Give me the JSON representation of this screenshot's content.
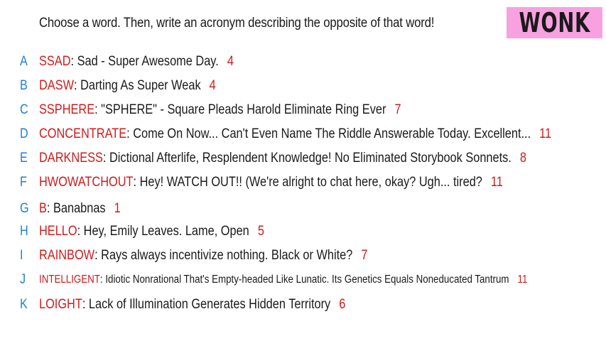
{
  "prompt": "Choose a word. Then, write an acronym describing the opposite of that word!",
  "logo": "WONK",
  "colors": {
    "letter": "#1e7fd6",
    "word": "#d21a1a",
    "score": "#d21a1a",
    "logo_bg": "#f7a1e0"
  },
  "entries": [
    {
      "letter": "A",
      "word": "SSAD",
      "expansion": "Sad - Super Awesome Day.",
      "score": "4"
    },
    {
      "letter": "B",
      "word": "DASW",
      "expansion": "Darting As Super Weak",
      "score": "4"
    },
    {
      "letter": "C",
      "word": "SSPHERE",
      "expansion": "\"SPHERE\" - Square Pleads Harold Eliminate Ring Ever",
      "score": "7"
    },
    {
      "letter": "D",
      "word": "CONCENTRATE",
      "expansion": "Come On Now... Can't Even Name The Riddle Answerable Today. Excellent...",
      "score": "11"
    },
    {
      "letter": "E",
      "word": "DARKNESS",
      "expansion": "Dictional Afterlife, Resplendent Knowledge! No Eliminated Storybook Sonnets.",
      "score": "8"
    },
    {
      "letter": "F",
      "word": "HWOWATCHOUT",
      "expansion": "Hey! WATCH OUT!! (We're alright to chat here, okay? Ugh... tired?",
      "score": "11"
    },
    {
      "letter": "G",
      "word": "B",
      "expansion": "Banabnas",
      "score": "1"
    },
    {
      "letter": "H",
      "word": "HELLO",
      "expansion": "Hey, Emily Leaves. Lame, Open",
      "score": "5"
    },
    {
      "letter": "I",
      "word": "RAINBOW",
      "expansion": "Rays always incentivize nothing. Black or White?",
      "score": "7"
    },
    {
      "letter": "J",
      "word": "INTELLIGENT",
      "expansion": "Idiotic Nonrational That's Empty-headed Like Lunatic. Its Genetics Equals Noneducated Tantrum",
      "score": "11"
    },
    {
      "letter": "K",
      "word": "LOIGHT",
      "expansion": "Lack of Illumination Generates Hidden Territory",
      "score": "6"
    }
  ]
}
